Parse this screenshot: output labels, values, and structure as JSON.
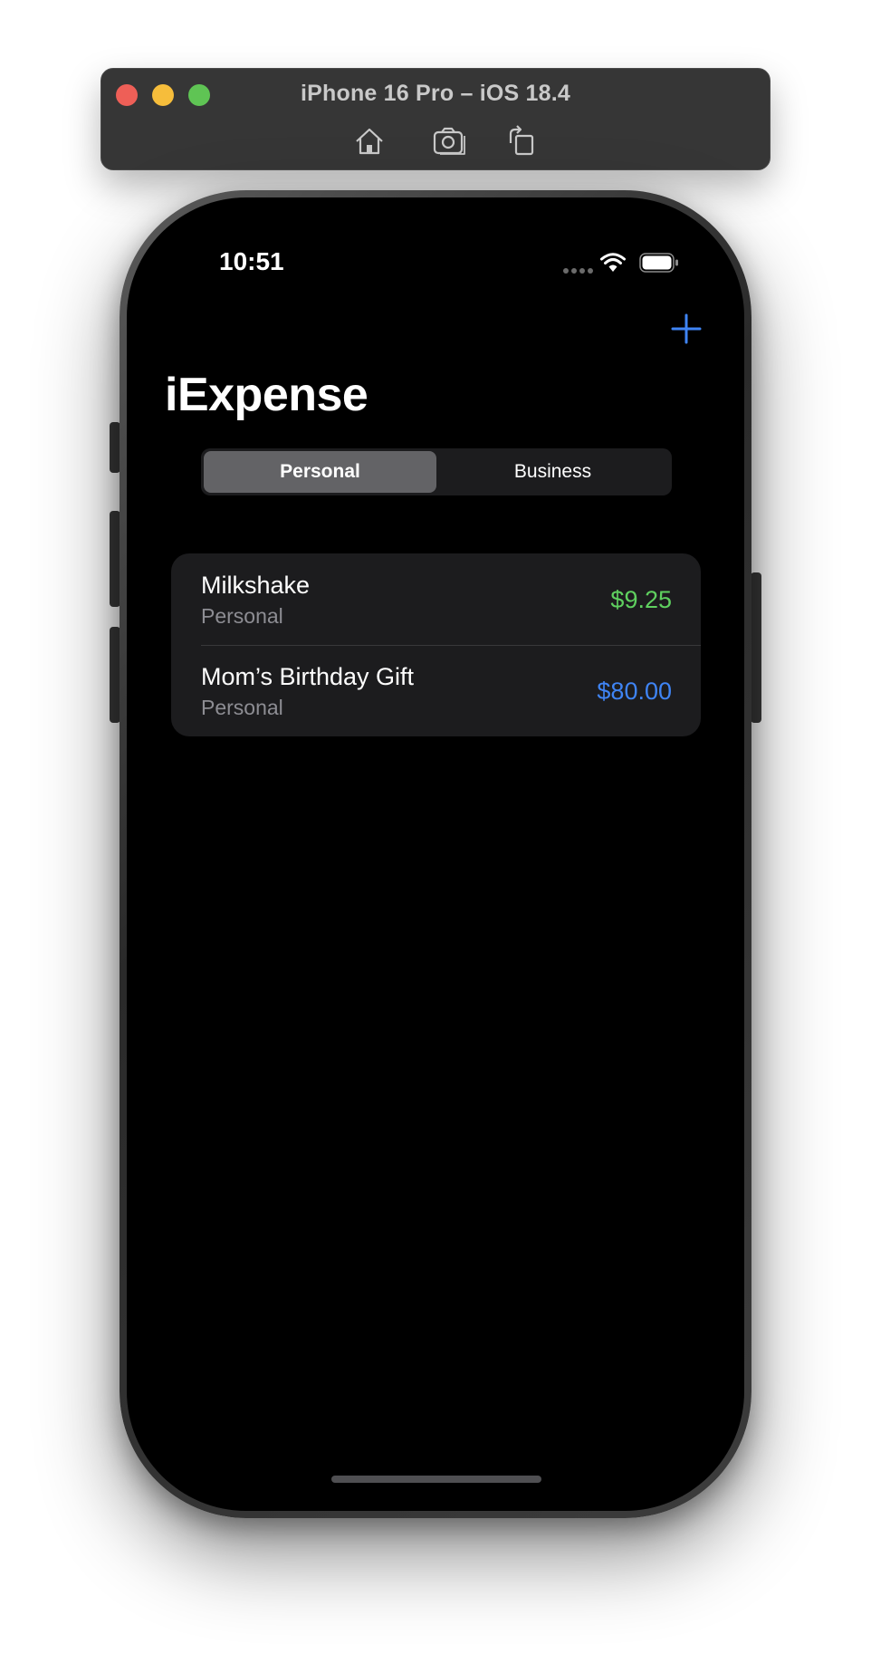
{
  "simulator": {
    "title": "iPhone 16 Pro – iOS 18.4",
    "toolbar": [
      "home-icon",
      "screenshot-icon",
      "rotate-icon"
    ]
  },
  "status_bar": {
    "time": "10:51",
    "icons": [
      "cellular-signal-icon",
      "wifi-icon",
      "battery-icon"
    ]
  },
  "nav": {
    "add_icon": "plus-icon",
    "title": "iExpense"
  },
  "segmented": {
    "options": [
      "Personal",
      "Business"
    ],
    "selected": "Personal"
  },
  "expenses": [
    {
      "name": "Milkshake",
      "type": "Personal",
      "amount": "$9.25",
      "amount_color": "#5fd05f"
    },
    {
      "name": "Mom’s Birthday Gift",
      "type": "Personal",
      "amount": "$80.00",
      "amount_color": "#3f84f4"
    }
  ],
  "colors": {
    "accent": "#3f84f4",
    "background": "#000000",
    "cell_background": "#1c1c1e",
    "secondary_text": "#8d8d93",
    "selected_segment": "#636366"
  }
}
